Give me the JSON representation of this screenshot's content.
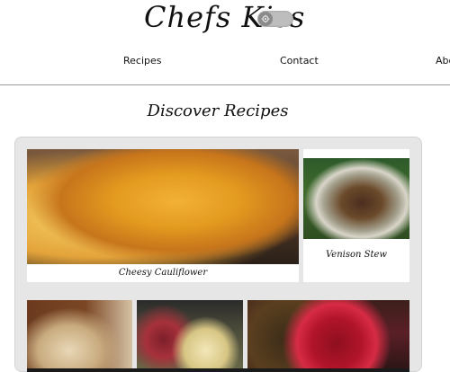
{
  "header": {
    "brand": "Chefs Kiss",
    "theme_toggle": {
      "state": "off",
      "icon": "gear-icon"
    }
  },
  "nav": {
    "items": [
      {
        "label": "Recipes"
      },
      {
        "label": "Contact"
      },
      {
        "label": "Abo"
      }
    ]
  },
  "main": {
    "title": "Discover Recipes",
    "cards": [
      {
        "label": "Cheesy Cauliflower"
      },
      {
        "label": "Venison Stew"
      },
      {
        "label": ""
      },
      {
        "label": ""
      },
      {
        "label": ""
      }
    ]
  }
}
